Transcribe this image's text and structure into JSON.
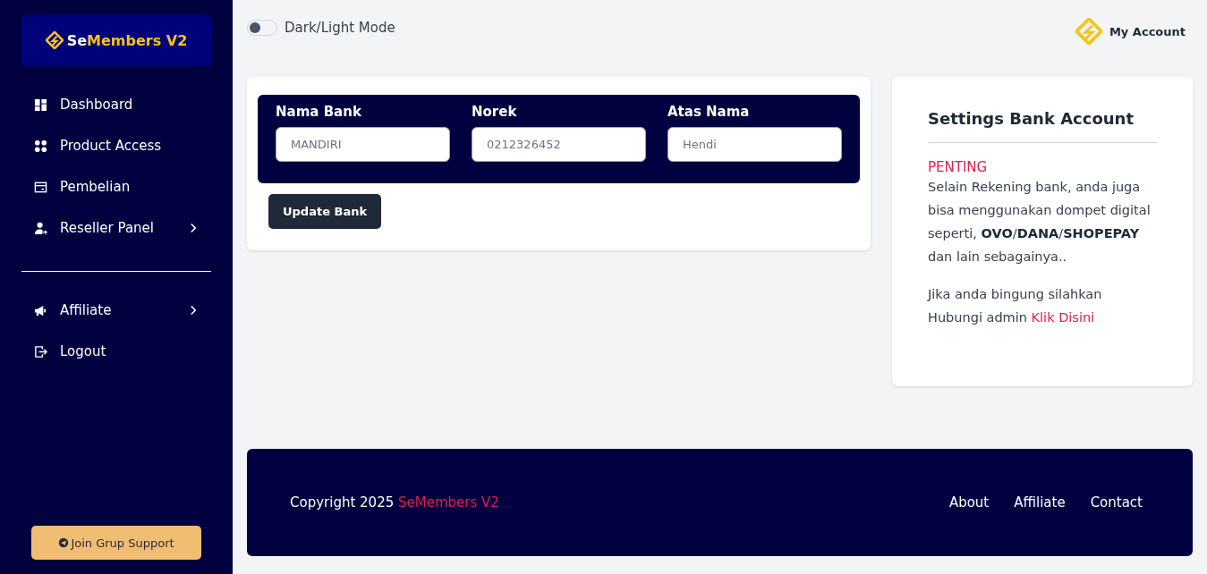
{
  "sidebar": {
    "logo": {
      "lead": "Se",
      "rest": "Members V2"
    },
    "menu": [
      {
        "label": "Dashboard",
        "kind": "link"
      },
      {
        "label": "Product Access",
        "kind": "link"
      },
      {
        "label": "Pembelian",
        "kind": "link"
      },
      {
        "label": "Reseller Panel",
        "kind": "submenu"
      }
    ],
    "menu_2": [
      {
        "label": "Affiliate",
        "kind": "submenu"
      },
      {
        "label": "Logout",
        "kind": "link"
      }
    ],
    "support_button": "Join Grup Support"
  },
  "topbar": {
    "mode_toggle": {
      "label": "Dark/Light Mode",
      "on": false
    },
    "account": "My Account"
  },
  "bank_form": {
    "fields": [
      {
        "label": "Nama Bank",
        "value": "MANDIRI"
      },
      {
        "label": "Norek",
        "value": "0212326452"
      },
      {
        "label": "Atas Nama",
        "value": "Hendi"
      }
    ],
    "button": "Update Bank"
  },
  "info_card": {
    "title": "Settings Bank Account",
    "alert": "PENTING",
    "text": "Selain Rekening bank, anda juga bisa menggunakan dompet digital seperti, **OVO**/**DANA**/**SHOPEPAY** dan lain sebagainya..",
    "contact_text": "Jika anda bingung silahkan Hubungi admin",
    "contact_link": "Klik Disini"
  },
  "footer": {
    "copyright": "Copyright 2025",
    "brand": "SeMembers V2",
    "links": [
      "About",
      "Affiliate",
      "Contact"
    ]
  }
}
